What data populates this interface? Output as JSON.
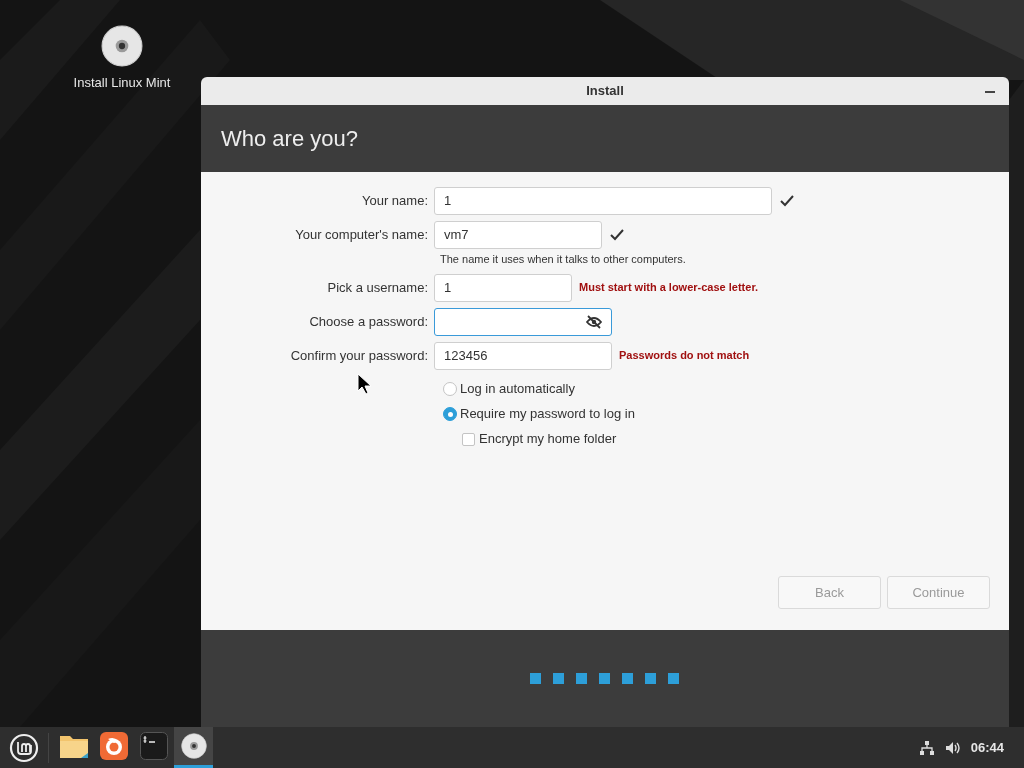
{
  "desktop": {
    "icons": [
      {
        "label": "Install Linux Mint"
      }
    ]
  },
  "window": {
    "title": "Install",
    "heading": "Who are you?"
  },
  "form": {
    "fields": [
      {
        "kind": "text",
        "label": "Your name:",
        "value": "1",
        "valid": true,
        "focused": false
      },
      {
        "kind": "text",
        "label": "Your computer's name:",
        "value": "vm7",
        "valid": true,
        "focused": false,
        "hint": "The name it uses when it talks to other computers."
      },
      {
        "kind": "text",
        "label": "Pick a username:",
        "value": "1",
        "valid": false,
        "focused": false,
        "error": "Must start with a lower-case letter."
      },
      {
        "kind": "password",
        "label": "Choose a password:",
        "valid": false,
        "focused": true
      },
      {
        "kind": "text",
        "label": "Confirm your password:",
        "value": "123456",
        "valid": false,
        "focused": false,
        "error": "Passwords do not match"
      }
    ],
    "options": [
      {
        "kind": "radio",
        "label": "Log in automatically",
        "selected": false
      },
      {
        "kind": "radio",
        "label": "Require my password to log in",
        "selected": true
      },
      {
        "kind": "checkbox",
        "label": "Encrypt my home folder",
        "checked": false
      }
    ]
  },
  "buttons": [
    {
      "label": "Back",
      "disabled": true
    },
    {
      "label": "Continue",
      "disabled": true
    }
  ],
  "taskbar": {
    "apps": [
      {
        "kind": "files",
        "active": false
      },
      {
        "kind": "browser",
        "active": false
      },
      {
        "kind": "terminal",
        "active": false
      },
      {
        "kind": "disc",
        "active": true
      }
    ],
    "clock": "06:44"
  }
}
